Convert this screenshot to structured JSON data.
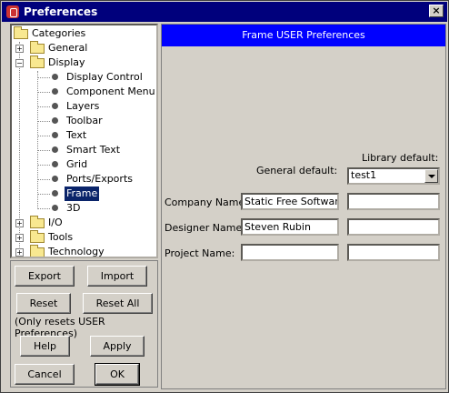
{
  "window": {
    "title": "Preferences",
    "close_symbol": "×"
  },
  "tree": {
    "root": "Categories",
    "items": [
      {
        "label": "General",
        "expander": "+"
      },
      {
        "label": "Display",
        "expander": "−"
      },
      {
        "label": "Display Control"
      },
      {
        "label": "Component Menu"
      },
      {
        "label": "Layers"
      },
      {
        "label": "Toolbar"
      },
      {
        "label": "Text"
      },
      {
        "label": "Smart Text"
      },
      {
        "label": "Grid"
      },
      {
        "label": "Ports/Exports"
      },
      {
        "label": "Frame",
        "selected": true
      },
      {
        "label": "3D"
      },
      {
        "label": "I/O",
        "expander": "+"
      },
      {
        "label": "Tools",
        "expander": "+"
      },
      {
        "label": "Technology",
        "expander": "+"
      }
    ]
  },
  "buttons": {
    "export": "Export",
    "import": "Import",
    "reset": "Reset",
    "reset_all": "Reset All",
    "reset_note": "(Only resets USER Preferences)",
    "help": "Help",
    "apply": "Apply",
    "cancel": "Cancel",
    "ok": "OK"
  },
  "panel": {
    "header": "Frame USER Preferences",
    "library_default_label": "Library default:",
    "general_default_label": "General default:",
    "library_select_value": "test1",
    "rows": [
      {
        "label": "Company Name:",
        "general": "Static Free Software",
        "library": ""
      },
      {
        "label": "Designer Name:",
        "general": "Steven Rubin",
        "library": ""
      },
      {
        "label": "Project Name:",
        "general": "",
        "library": ""
      }
    ]
  }
}
